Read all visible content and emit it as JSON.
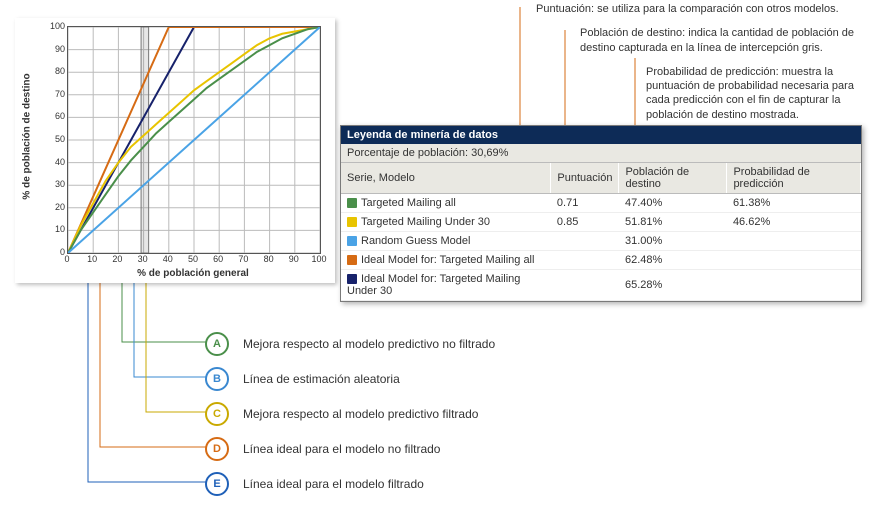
{
  "chart_data": {
    "type": "line",
    "xlabel": "% de población general",
    "ylabel": "% de población de destino",
    "xlim": [
      0,
      100
    ],
    "ylim": [
      0,
      100
    ],
    "x_ticks": [
      0,
      10,
      20,
      30,
      40,
      50,
      60,
      70,
      80,
      90,
      100
    ],
    "y_ticks": [
      0,
      10,
      20,
      30,
      40,
      50,
      60,
      70,
      80,
      90,
      100
    ],
    "intercept_band": [
      29,
      32
    ],
    "series": [
      {
        "name": "Ideal Model for: Targeted Mailing Under 30",
        "color": "#17226b",
        "x": [
          0,
          50,
          100
        ],
        "y": [
          0,
          100,
          100
        ]
      },
      {
        "name": "Ideal Model for: Targeted Mailing all",
        "color": "#d66b14",
        "x": [
          0,
          40,
          100
        ],
        "y": [
          0,
          100,
          100
        ]
      },
      {
        "name": "Targeted Mailing Under 30",
        "color": "#e8c400",
        "x": [
          0,
          5,
          10,
          15,
          20,
          25,
          30,
          35,
          40,
          45,
          50,
          55,
          60,
          65,
          70,
          75,
          80,
          85,
          90,
          95,
          100
        ],
        "y": [
          0,
          12,
          22,
          32,
          40,
          47,
          52,
          57,
          62,
          67,
          72,
          76,
          80,
          84,
          88,
          92,
          95,
          97,
          98,
          99,
          100
        ]
      },
      {
        "name": "Targeted Mailing all",
        "color": "#4a8f4a",
        "x": [
          0,
          5,
          10,
          15,
          20,
          25,
          30,
          35,
          40,
          45,
          50,
          55,
          60,
          65,
          70,
          75,
          80,
          85,
          90,
          95,
          100
        ],
        "y": [
          0,
          10,
          18,
          26,
          34,
          41,
          47,
          53,
          58,
          63,
          68,
          73,
          77,
          81,
          85,
          89,
          92,
          95,
          97,
          99,
          100
        ]
      },
      {
        "name": "Random Guess Model",
        "color": "#4aa3e6",
        "x": [
          0,
          100
        ],
        "y": [
          0,
          100
        ]
      }
    ]
  },
  "legend": {
    "title": "Leyenda de minería de datos",
    "population_label": "Porcentaje de población: 30,69%",
    "columns": {
      "series": "Serie, Modelo",
      "score": "Puntuación",
      "target": "Población de destino",
      "prob": "Probabilidad de predicción"
    },
    "rows": [
      {
        "color": "#4a8f4a",
        "model": "Targeted Mailing all",
        "score": "0.71",
        "target": "47.40%",
        "prob": "61.38%"
      },
      {
        "color": "#e8c400",
        "model": "Targeted Mailing Under 30",
        "score": "0.85",
        "target": "51.81%",
        "prob": "46.62%"
      },
      {
        "color": "#4aa3e6",
        "model": "Random Guess Model",
        "score": "",
        "target": "31.00%",
        "prob": ""
      },
      {
        "color": "#d66b14",
        "model": "Ideal Model for: Targeted Mailing all",
        "score": "",
        "target": "62.48%",
        "prob": ""
      },
      {
        "color": "#17226b",
        "model": "Ideal Model for: Targeted Mailing Under 30",
        "score": "",
        "target": "65.28%",
        "prob": ""
      }
    ]
  },
  "callouts_top": [
    {
      "text": "Puntuación: se utiliza para la comparación con otros modelos.",
      "color": "#d66b14"
    },
    {
      "text": "Población de destino: indica la cantidad de población de destino capturada en la línea de intercepción gris.",
      "color": "#d66b14"
    },
    {
      "text": "Probabilidad de predicción: muestra la puntuación de probabilidad necesaria para cada predicción con el fin de capturar la población de destino mostrada.",
      "color": "#d66b14"
    }
  ],
  "letter_legend": [
    {
      "letter": "A",
      "color": "#4a8f4a",
      "label": "Mejora respecto al modelo predictivo no filtrado"
    },
    {
      "letter": "B",
      "color": "#3a88d0",
      "label": "Línea de estimación aleatoria"
    },
    {
      "letter": "C",
      "color": "#c9a900",
      "label": "Mejora respecto al modelo predictivo filtrado"
    },
    {
      "letter": "D",
      "color": "#d66b14",
      "label": "Línea ideal para el modelo no filtrado"
    },
    {
      "letter": "E",
      "color": "#1f60b8",
      "label": "Línea ideal para el modelo filtrado"
    }
  ]
}
